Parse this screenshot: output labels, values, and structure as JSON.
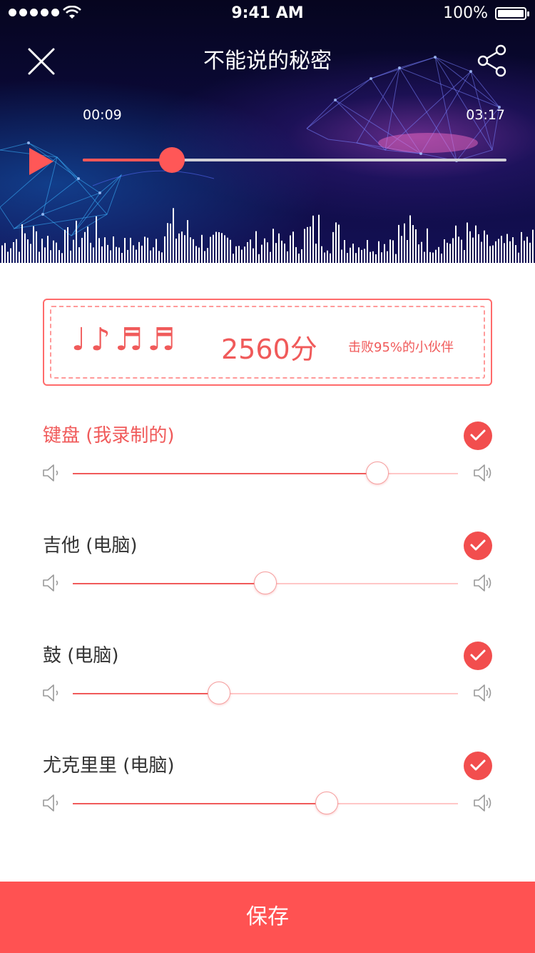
{
  "status_bar": {
    "time": "9:41 AM",
    "battery": "100%"
  },
  "header": {
    "title": "不能说的秘密"
  },
  "player": {
    "current_time": "00:09",
    "total_time": "03:17",
    "progress": 0.21
  },
  "score": {
    "notes": "♩♪♬♬",
    "value": "2560分",
    "subtitle": "击败95%的小伙伴"
  },
  "tracks": [
    {
      "name": "键盘 (我录制的)",
      "checked": true,
      "volume": 0.79
    },
    {
      "name": "吉他 (电脑)",
      "checked": true,
      "volume": 0.5
    },
    {
      "name": "鼓 (电脑)",
      "checked": true,
      "volume": 0.38
    },
    {
      "name": "尤克里里 (电脑)",
      "checked": true,
      "volume": 0.66
    }
  ],
  "footer": {
    "save_label": "保存"
  },
  "colors": {
    "accent": "#ff5757",
    "track_bg": "#ffc7c7"
  }
}
